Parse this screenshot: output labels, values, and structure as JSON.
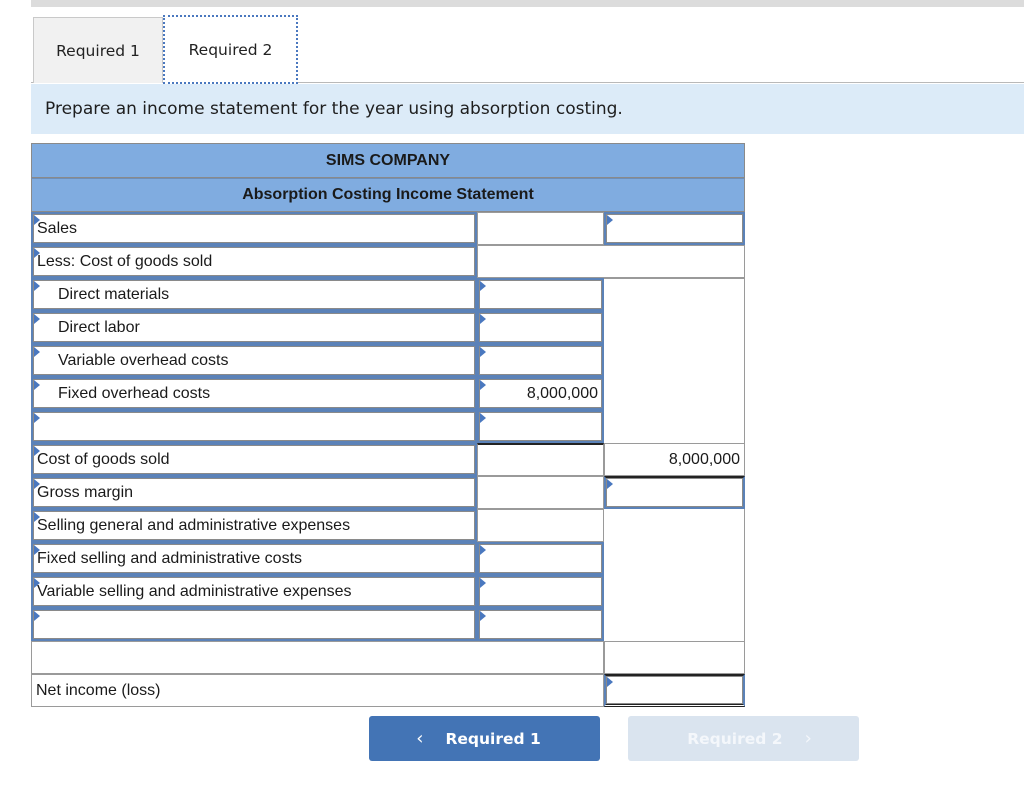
{
  "tabs": [
    {
      "label": "Required 1",
      "active": false
    },
    {
      "label": "Required 2",
      "active": true
    }
  ],
  "instruction": "Prepare an income statement for the year using absorption costing.",
  "statement": {
    "company": "SIMS COMPANY",
    "title": "Absorption Costing Income Statement",
    "rows": [
      {
        "label": "Sales",
        "mid": "",
        "right": ""
      },
      {
        "label": "Less: Cost of goods sold",
        "mid": "",
        "right": ""
      },
      {
        "label": "Direct materials",
        "mid": "",
        "right": ""
      },
      {
        "label": "Direct labor",
        "mid": "",
        "right": ""
      },
      {
        "label": "Variable overhead costs",
        "mid": "",
        "right": ""
      },
      {
        "label": "Fixed overhead costs",
        "mid": "8,000,000",
        "right": ""
      },
      {
        "label": "",
        "mid": "",
        "right": ""
      },
      {
        "label": "Cost of goods sold",
        "mid": "",
        "right": "8,000,000"
      },
      {
        "label": "Gross margin",
        "mid": "",
        "right": ""
      },
      {
        "label": "Selling general and administrative expenses",
        "mid": "",
        "right": ""
      },
      {
        "label": "Fixed selling and administrative costs",
        "mid": "",
        "right": ""
      },
      {
        "label": "Variable selling and administrative expenses",
        "mid": "",
        "right": ""
      },
      {
        "label": "",
        "mid": "",
        "right": ""
      },
      {
        "label": "",
        "mid": "",
        "right": ""
      },
      {
        "label": "Net income (loss)",
        "mid": "",
        "right": ""
      }
    ]
  },
  "nav": {
    "prev_label": "Required 1",
    "prev_icon": "chevron-left-icon",
    "next_label": "Required 2",
    "next_icon": "chevron-right-icon",
    "next_disabled": true
  },
  "colors": {
    "header_bg": "#80ace0",
    "instruction_bg": "#dcebf8",
    "prev_button": "#4374b5",
    "next_button_disabled": "#dae4ef",
    "input_border": "#5b82b8"
  }
}
